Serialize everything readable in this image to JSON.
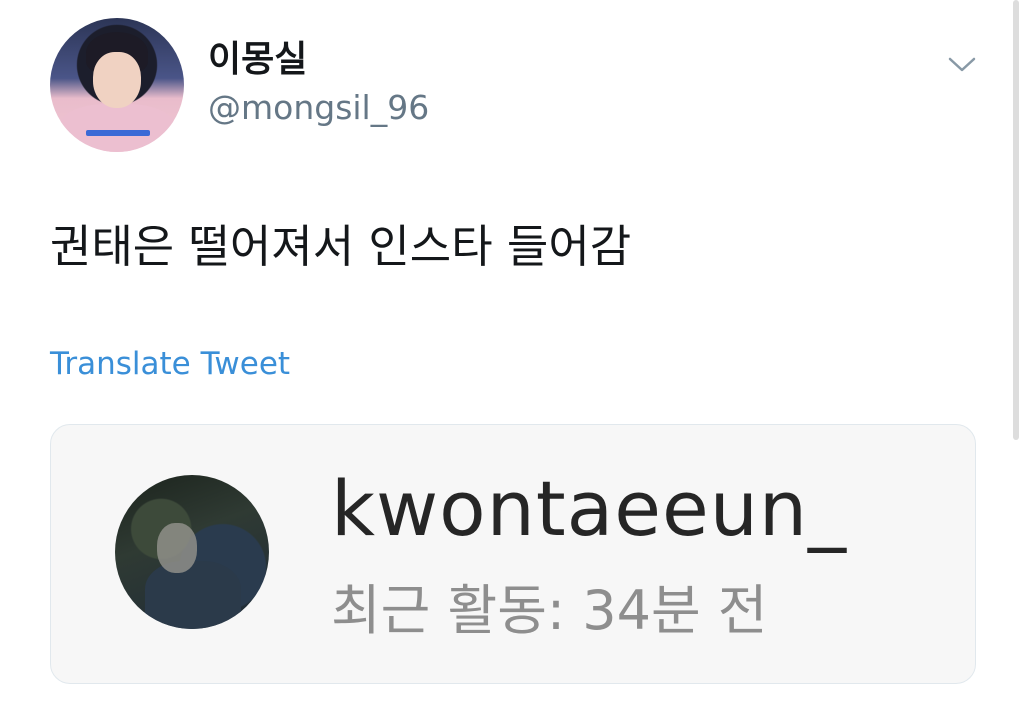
{
  "tweet": {
    "display_name": "이몽실",
    "handle": "@mongsil_96",
    "text": "권태은 떨어져서 인스타 들어감",
    "translate_label": "Translate Tweet",
    "more_icon": "chevron-down-icon"
  },
  "media_card": {
    "username": "kwontaeeun_",
    "activity": "최근 활동: 34분 전"
  },
  "colors": {
    "link": "#3a8fd8",
    "handle": "#657786",
    "text": "#14171a"
  }
}
